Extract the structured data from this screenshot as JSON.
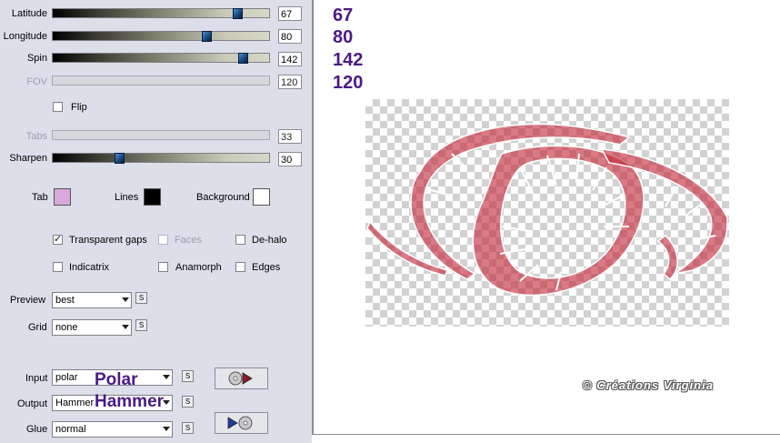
{
  "sliders": [
    {
      "label": "Latitude",
      "value": "67",
      "fraction": 0.85,
      "enabled": true
    },
    {
      "label": "Longitude",
      "value": "80",
      "fraction": 0.7,
      "enabled": true
    },
    {
      "label": "Spin",
      "value": "142",
      "fraction": 0.87,
      "enabled": true
    },
    {
      "label": "FOV",
      "value": "120",
      "enabled": false
    },
    {
      "label": "Tabs",
      "value": "33",
      "enabled": false
    },
    {
      "label": "Sharpen",
      "value": "30",
      "fraction": 0.31,
      "enabled": true
    }
  ],
  "flip": {
    "label": "Flip",
    "checked": false
  },
  "colors": {
    "tab": {
      "label": "Tab",
      "color": "#d9a8dc"
    },
    "lines": {
      "label": "Lines",
      "color": "#000000"
    },
    "background": {
      "label": "Background",
      "color": "#ffffff"
    }
  },
  "options": {
    "transparent_gaps": {
      "label": "Transparent gaps",
      "checked": true
    },
    "faces": {
      "label": "Faces",
      "checked": false,
      "enabled": false
    },
    "de_halo": {
      "label": "De-halo",
      "checked": false
    },
    "indicatrix": {
      "label": "Indicatrix",
      "checked": false
    },
    "anamorph": {
      "label": "Anamorph",
      "checked": false
    },
    "edges": {
      "label": "Edges",
      "checked": false
    }
  },
  "preview": {
    "label": "Preview",
    "value": "best"
  },
  "grid": {
    "label": "Grid",
    "value": "none"
  },
  "input": {
    "label": "Input",
    "value": "polar",
    "annotation": "Polar"
  },
  "output": {
    "label": "Output",
    "value": "Hammer",
    "annotation": "Hammer"
  },
  "glue": {
    "label": "Glue",
    "value": "normal"
  },
  "s_button_label": "S",
  "annotations": {
    "values": [
      "67",
      "80",
      "142",
      "120"
    ]
  },
  "credit": "© Créations Virginia",
  "accent_color": "#4b1a86"
}
